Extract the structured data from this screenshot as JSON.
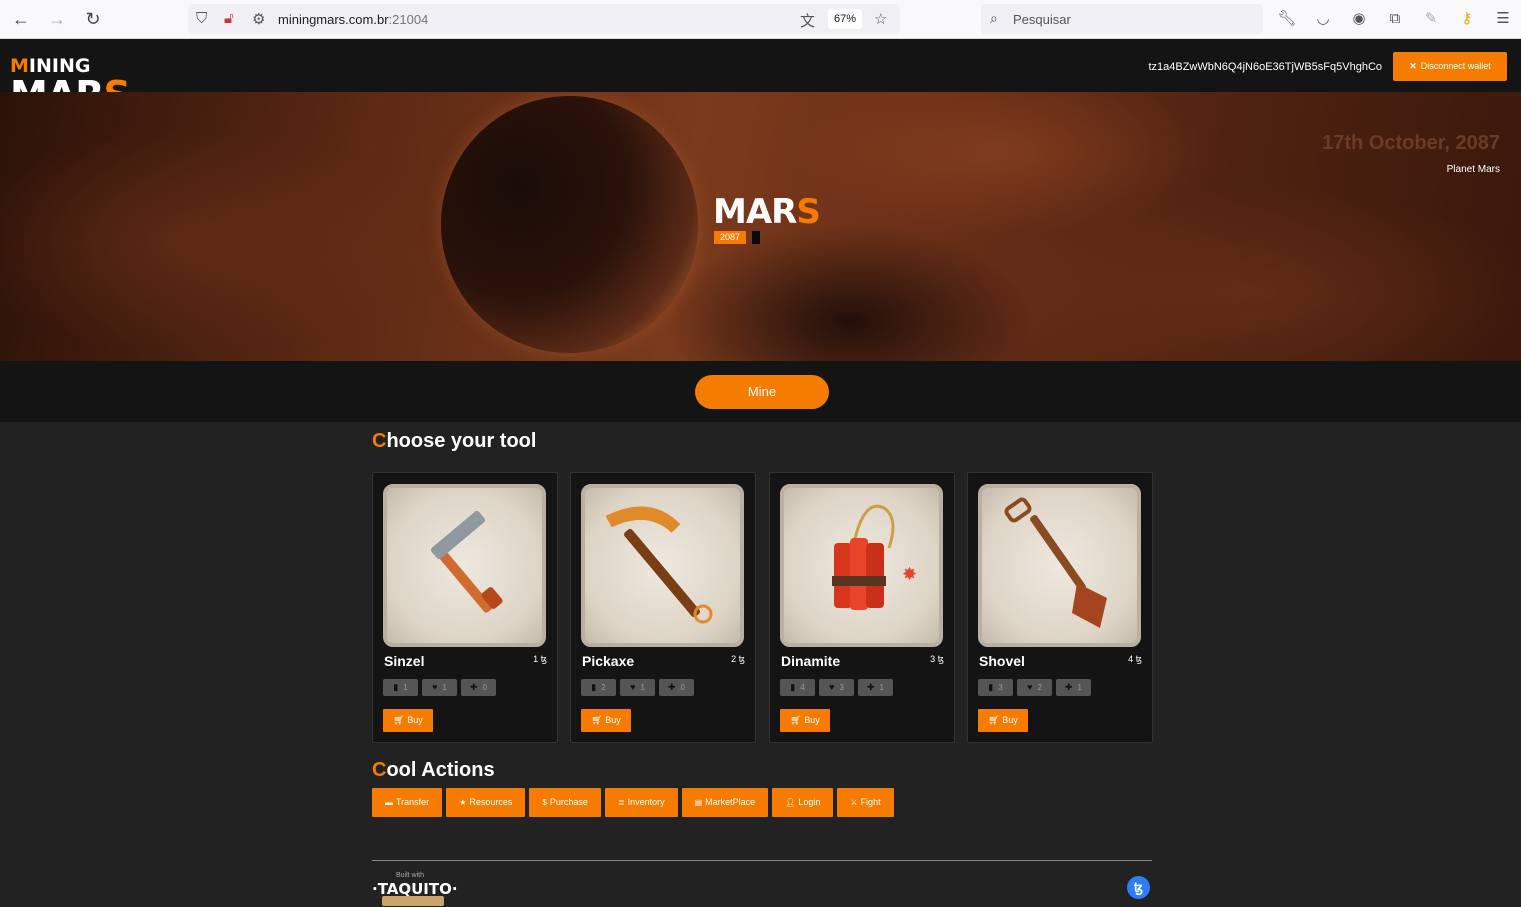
{
  "browser": {
    "url_host": "miningmars.com.br",
    "url_port": ":21004",
    "zoom": "67%",
    "search_placeholder": "Pesquisar"
  },
  "header": {
    "logo_line1_accent": "M",
    "logo_line1_rest": "INING",
    "logo_line2_main": "MAR",
    "logo_line2_accent": "S",
    "wallet_address": "tz1a4BZwWbN6Q4jN6oE36TjWB5sFq5VhghCo",
    "disconnect_label": "Disconnect wallet"
  },
  "hero": {
    "title_main": "MAR",
    "title_accent": "S",
    "year": "2087",
    "date": "17th October, 2087",
    "place": "Planet Mars"
  },
  "mine_label": "Mine",
  "tools_section": {
    "title_accent": "C",
    "title_rest": "hoose your tool",
    "tools": [
      {
        "name": "Sinzel",
        "price": "1 ꜩ",
        "stats": [
          "1",
          "1",
          "0"
        ],
        "buy": "Buy"
      },
      {
        "name": "Pickaxe",
        "price": "2 ꜩ",
        "stats": [
          "2",
          "1",
          "0"
        ],
        "buy": "Buy"
      },
      {
        "name": "Dinamite",
        "price": "3 ꜩ",
        "stats": [
          "4",
          "3",
          "1"
        ],
        "buy": "Buy"
      },
      {
        "name": "Shovel",
        "price": "4 ꜩ",
        "stats": [
          "3",
          "2",
          "1"
        ],
        "buy": "Buy"
      }
    ]
  },
  "actions_section": {
    "title_accent": "C",
    "title_rest": "ool Actions",
    "buttons": [
      "Transfer",
      "Resources",
      "Purchase",
      "Inventory",
      "MarketPlace",
      "Login",
      "Fight"
    ]
  },
  "footer": {
    "built_with": "Built with",
    "brand": "·TAQUITO·",
    "tezos_symbol": "ꜩ"
  },
  "colors": {
    "accent": "#f57c00",
    "background": "#222222",
    "bar": "#141414"
  }
}
